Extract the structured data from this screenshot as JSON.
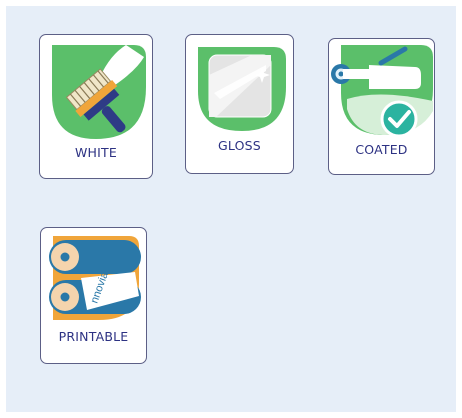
{
  "colors": {
    "panel_bg": "#e6eef8",
    "card_border": "#5c5f86",
    "label_text": "#2d3283",
    "leaf_green": "#5bbf6a",
    "roller_blue": "#2a78a8",
    "roller_orange": "#f0a53a",
    "check_teal": "#2bb3a0"
  },
  "cards": [
    {
      "label": "WHITE",
      "icon": "paint-brush-icon"
    },
    {
      "label": "GLOSS",
      "icon": "glossy-surface-icon"
    },
    {
      "label": "COATED",
      "icon": "paint-roller-check-icon"
    },
    {
      "label": "PRINTABLE",
      "icon": "printable-roll-icon"
    }
  ],
  "printable_roll_text": "nnovia"
}
